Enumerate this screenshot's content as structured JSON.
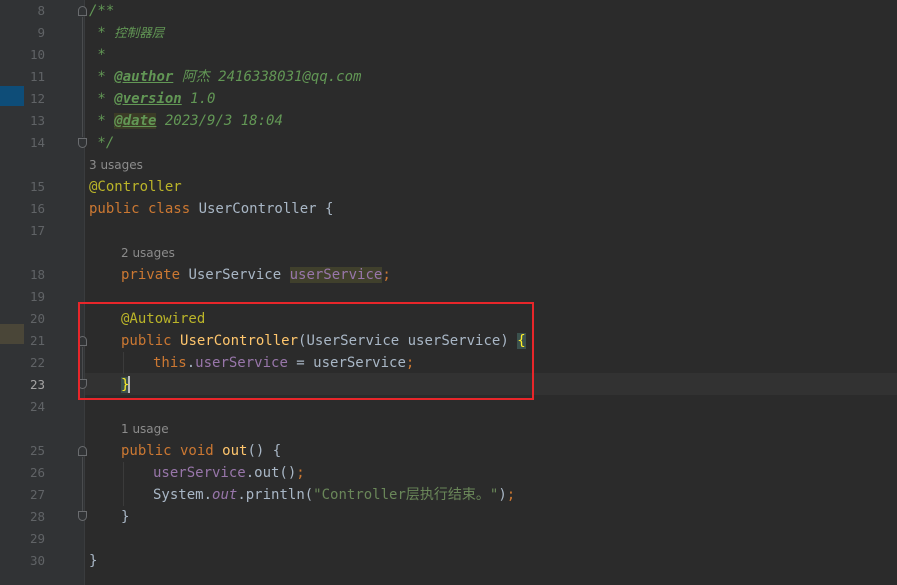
{
  "editor": {
    "line_numbers": [
      "8",
      "9",
      "10",
      "11",
      "12",
      "13",
      "14",
      "15",
      "16",
      "17",
      "18",
      "19",
      "20",
      "21",
      "22",
      "23",
      "24",
      "25",
      "26",
      "27",
      "28",
      "29",
      "30"
    ],
    "current_line": "23",
    "usage_hints": {
      "class": "3 usages",
      "field": "2 usages",
      "method": "1 usage"
    },
    "code": {
      "l8": "/**",
      "l9_star": " * ",
      "l9_text": "控制器层",
      "l10": " *",
      "l11_star": " * ",
      "l11_tag": "@author",
      "l11_text": " 阿杰 2416338031@qq.com",
      "l12_star": " * ",
      "l12_tag": "@version",
      "l12_text": " 1.0",
      "l13_star": " * ",
      "l13_tag": "@date",
      "l13_text": " 2023/9/3 18:04",
      "l14": " */",
      "l15": "@Controller",
      "l16_kw": "public class ",
      "l16_name": "UserController ",
      "l16_brace": "{",
      "l18_kw": "private ",
      "l18_type": "UserService ",
      "l18_field": "userService",
      "l18_semi": ";",
      "l20": "@Autowired",
      "l21_kw": "public ",
      "l21_fn": "UserController",
      "l21_params": "(UserService userService) ",
      "l21_brace": "{",
      "l22_this": "this",
      "l22_dot": ".",
      "l22_field": "userService",
      "l22_rest": " = userService",
      "l22_semi": ";",
      "l23": "}",
      "l25_kw": "public void ",
      "l25_fn": "out",
      "l25_parens": "() ",
      "l25_brace": "{",
      "l26_field": "userService",
      "l26_rest": ".out()",
      "l26_semi": ";",
      "l27_sys": "System.",
      "l27_out": "out",
      "l27_mid": ".println(",
      "l27_str": "\"Controller层执行结束。\"",
      "l27_end": ")",
      "l27_semi": ";",
      "l28": "}",
      "l30": "}"
    }
  }
}
